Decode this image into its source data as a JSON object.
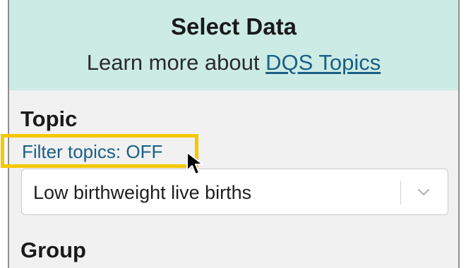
{
  "header": {
    "title": "Select Data",
    "subtitle_prefix": "Learn more about ",
    "subtitle_link": "DQS Topics"
  },
  "topic": {
    "label": "Topic",
    "filter_toggle": "Filter topics: OFF",
    "selected_value": "Low birthweight live births"
  },
  "group": {
    "label": "Group"
  },
  "icons": {
    "dropdown": "chevron-down-icon",
    "cursor": "mouse-pointer-icon"
  },
  "colors": {
    "header_background": "#cdebe5",
    "panel_background": "#f1f1f1",
    "link": "#1a5f85",
    "highlight": "#f5c800"
  }
}
